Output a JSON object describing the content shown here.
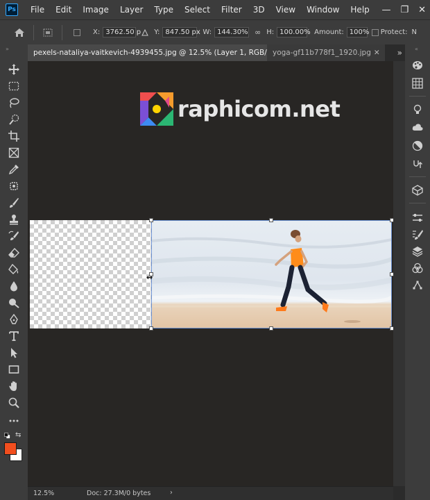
{
  "app": {
    "logo": "Ps"
  },
  "menu": [
    "File",
    "Edit",
    "Image",
    "Layer",
    "Type",
    "Select",
    "Filter",
    "3D",
    "View",
    "Window",
    "Help"
  ],
  "window_controls": {
    "minimize": "—",
    "maximize": "❐",
    "close": "✕"
  },
  "options": {
    "x_label": "X:",
    "x_value": "3762.50 p",
    "y_label": "Y:",
    "y_value": "847.50 px",
    "w_label": "W:",
    "w_value": "144.30%",
    "h_label": "H:",
    "h_value": "100.00%",
    "amount_label": "Amount:",
    "amount_value": "100%",
    "protect_label": "Protect:",
    "protect_extra": "N"
  },
  "tabs": [
    {
      "label": "pexels-nataliya-vaitkevich-4939455.jpg @ 12.5% (Layer 1, RGB/8)",
      "close": "✕"
    },
    {
      "label": "yoga-gf11b778f1_1920.jpg",
      "close": "✕"
    }
  ],
  "tabs_more": "»",
  "watermark": {
    "text": "raphicom.net"
  },
  "colors": {
    "foreground": "#f24e1e",
    "background": "#ffffff",
    "accent": "#31a8ff"
  },
  "status": {
    "zoom": "12.5%",
    "doc": "Doc: 27.3M/0 bytes",
    "arrow": "›"
  }
}
